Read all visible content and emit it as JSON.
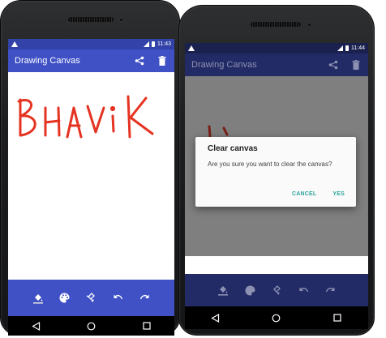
{
  "colors": {
    "primary": "#3f51c5",
    "primary_dark": "#3342a8",
    "ink": "#e53322",
    "accent": "#2ba39b"
  },
  "left_screen": {
    "status": {
      "time": "11:43",
      "icons": [
        "warning-icon",
        "signal-icon",
        "battery-icon"
      ]
    },
    "appbar": {
      "title": "Drawing Canvas",
      "actions": [
        "share-icon",
        "trash-icon"
      ]
    },
    "canvas": {
      "drawn_text": "BHAViK"
    },
    "toolbar": [
      "fill-bucket-icon",
      "palette-icon",
      "brush-icon",
      "undo-icon",
      "redo-icon"
    ],
    "navigation": [
      "back-icon",
      "home-icon",
      "recents-icon"
    ]
  },
  "right_screen": {
    "status": {
      "time": "11:44",
      "icons": [
        "warning-icon",
        "signal-icon",
        "battery-icon"
      ]
    },
    "appbar": {
      "title": "Drawing Canvas",
      "actions": [
        "share-icon",
        "trash-icon"
      ]
    },
    "dialog": {
      "title": "Clear canvas",
      "message": "Are you sure you want to clear the canvas?",
      "cancel_label": "CANCEL",
      "confirm_label": "YES"
    },
    "toolbar": [
      "fill-bucket-icon",
      "palette-icon",
      "brush-icon",
      "undo-icon",
      "redo-icon"
    ],
    "navigation": [
      "back-icon",
      "home-icon",
      "recents-icon"
    ]
  }
}
